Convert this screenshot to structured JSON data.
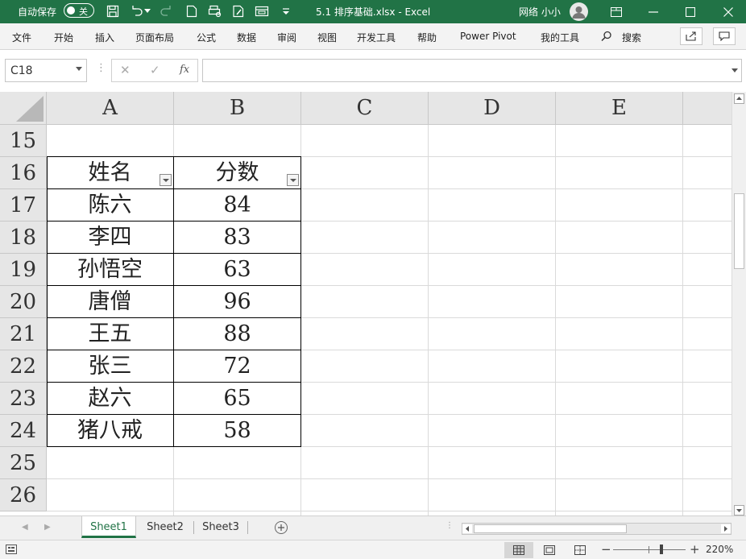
{
  "titlebar": {
    "autosave_label": "自动保存",
    "autosave_state": "关",
    "document_title": "5.1 排序基础.xlsx  -  Excel",
    "user_name": "网络 小小"
  },
  "menu": {
    "items": [
      "文件",
      "开始",
      "插入",
      "页面布局",
      "公式",
      "数据",
      "审阅",
      "视图",
      "开发工具",
      "帮助",
      "Power Pivot",
      "我的工具"
    ],
    "search_label": "搜索"
  },
  "formula_bar": {
    "name_box": "C18",
    "fx_label": "fx",
    "formula": ""
  },
  "grid": {
    "column_headers": [
      "A",
      "B",
      "C",
      "D",
      "E"
    ],
    "row_headers": [
      "15",
      "16",
      "17",
      "18",
      "19",
      "20",
      "21",
      "22",
      "23",
      "24",
      "25",
      "26"
    ],
    "table": {
      "headers": [
        "姓名",
        "分数"
      ],
      "rows": [
        [
          "陈六",
          "84"
        ],
        [
          "李四",
          "83"
        ],
        [
          "孙悟空",
          "63"
        ],
        [
          "唐僧",
          "96"
        ],
        [
          "王五",
          "88"
        ],
        [
          "张三",
          "72"
        ],
        [
          "赵六",
          "65"
        ],
        [
          "猪八戒",
          "58"
        ]
      ]
    }
  },
  "sheets": {
    "tabs": [
      "Sheet1",
      "Sheet2",
      "Sheet3"
    ],
    "active": "Sheet1"
  },
  "status": {
    "zoom": "220%"
  },
  "colors": {
    "excel_green": "#217346",
    "header_bg": "#e6e6e6"
  }
}
